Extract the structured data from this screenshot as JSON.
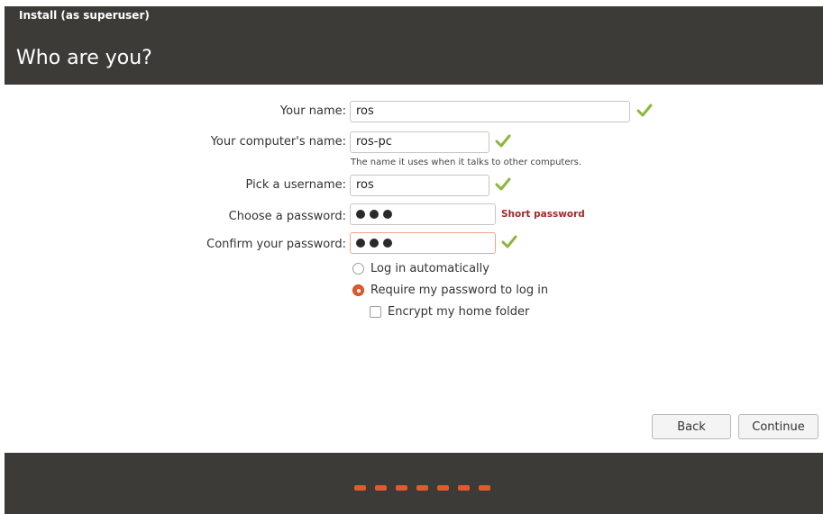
{
  "window": {
    "title": "Install (as superuser)"
  },
  "page": {
    "title": "Who are you?"
  },
  "form": {
    "name_label": "Your name:",
    "name_value": "ros",
    "computer_label": "Your computer's name:",
    "computer_value": "ros-pc",
    "computer_hint": "The name it uses when it talks to other computers.",
    "username_label": "Pick a username:",
    "username_value": "ros",
    "password_label": "Choose a password:",
    "password_length": 3,
    "password_status": "Short password",
    "confirm_label": "Confirm your password:",
    "confirm_length": 3
  },
  "login_options": {
    "auto": "Log in automatically",
    "require": "Require my password to log in",
    "selected": "require",
    "encrypt": "Encrypt my home folder",
    "encrypt_checked": false
  },
  "buttons": {
    "back": "Back",
    "continue": "Continue"
  },
  "progress": {
    "steps": 7
  },
  "colors": {
    "accent": "#e2592b",
    "check": "#8ab83a",
    "warning": "#a3292b",
    "chrome": "#3c3b37"
  }
}
